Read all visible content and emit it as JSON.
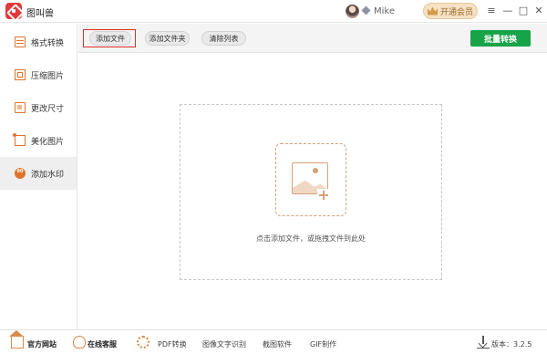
{
  "app": {
    "title": "图叫兽"
  },
  "user": {
    "name": "Mike"
  },
  "header": {
    "vip_label": "开通会员",
    "ctl_menu": "≡",
    "ctl_minimize": "—",
    "ctl_maximize": "□",
    "ctl_close": "✕"
  },
  "sidebar": {
    "items": [
      {
        "label": "格式转换",
        "icon": "format-convert-icon"
      },
      {
        "label": "压缩图片",
        "icon": "compress-icon"
      },
      {
        "label": "更改尺寸",
        "icon": "resize-icon"
      },
      {
        "label": "美化图片",
        "icon": "beautify-icon"
      },
      {
        "label": "添加水印",
        "icon": "watermark-icon",
        "active": true
      }
    ]
  },
  "toolbar": {
    "add_file": "添加文件",
    "add_folder": "添加文件夹",
    "clear_list": "清除列表",
    "batch_convert": "批量转换"
  },
  "dropzone": {
    "hint": "点击添加文件，或拖拽文件到此处"
  },
  "footer": {
    "official_site": "官方网站",
    "online_service": "在线客服",
    "pdf_convert": "PDF转换",
    "ocr": "图像文字识别",
    "screenshot": "截图软件",
    "gif": "GIF制作",
    "version": "版本：3.2.5"
  },
  "colors": {
    "accent": "#e0742c",
    "primary_button": "#18a349",
    "highlight": "#e0302a"
  }
}
